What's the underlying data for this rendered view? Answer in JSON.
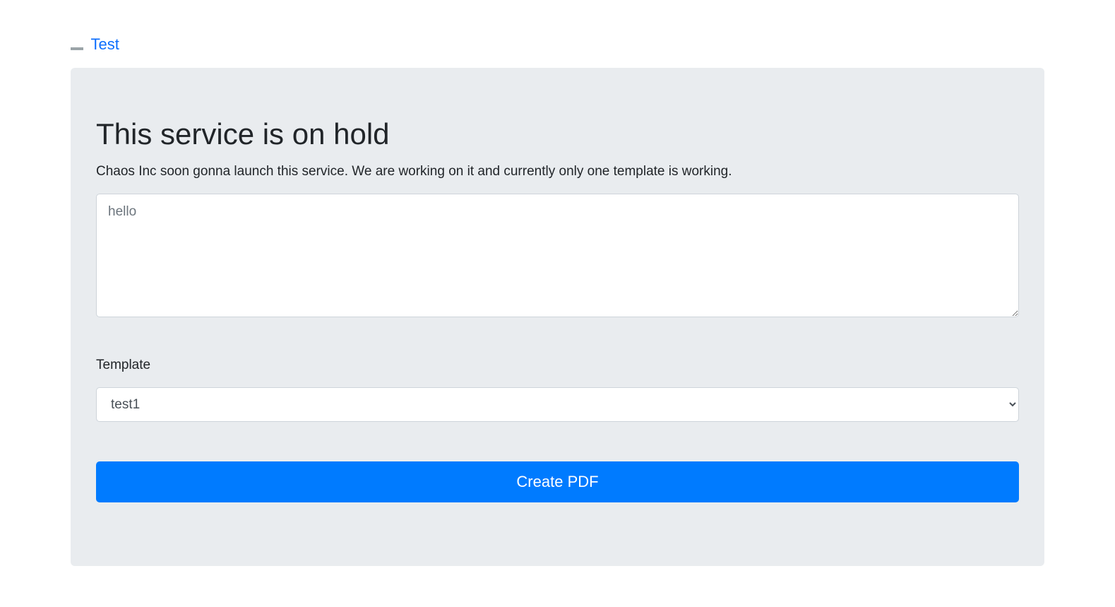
{
  "nav": {
    "link_label": "Test"
  },
  "main": {
    "heading": "This service is on hold",
    "description": "Chaos Inc soon gonna launch this service. We are working on it and currently only one template is working.",
    "textarea_placeholder": "hello",
    "textarea_value": "",
    "template_label": "Template",
    "template_selected": "test1",
    "create_button_label": "Create PDF"
  }
}
